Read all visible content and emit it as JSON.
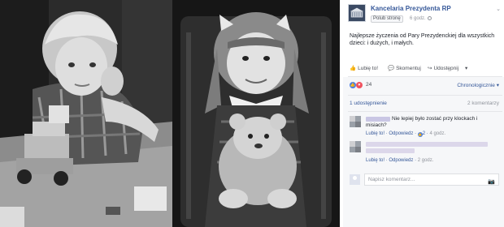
{
  "page": {
    "name": "Kancelaria Prezydenta RP",
    "follow_label": "Polub stronę",
    "time_ago": "6 godz.",
    "menu_chevron": "⌄"
  },
  "post": {
    "text": "Najlepsze życzenia od Pary Prezydenckiej dla wszystkich dzieci: i dużych, i małych."
  },
  "actions": {
    "like": "Lubię to!",
    "comment": "Skomentuj",
    "share": "Udostępnij",
    "like_icon": "👍",
    "comment_icon": "💬",
    "share_icon": "↪",
    "share_chevron": "▾"
  },
  "reactions": {
    "count": "24",
    "sort_label": "Chronologicznie ▾"
  },
  "stats": {
    "shares": "1 udostępnienie",
    "comments": "2 komentarzy"
  },
  "comments": [
    {
      "text": "Nie lepiej było zostać przy klockach i misiach?",
      "like": "Lubię to!",
      "reply": "Odpowiedz",
      "likes": "2",
      "time": "4 godz."
    },
    {
      "text": "",
      "like": "Lubię to!",
      "reply": "Odpowiedz",
      "time": "2 godz."
    }
  ],
  "composer": {
    "placeholder": "Napisz komentarz...",
    "camera_icon": "camera-icon"
  },
  "colors": {
    "link": "#365899",
    "like": "#4d7fe0",
    "love": "#f0525f"
  }
}
